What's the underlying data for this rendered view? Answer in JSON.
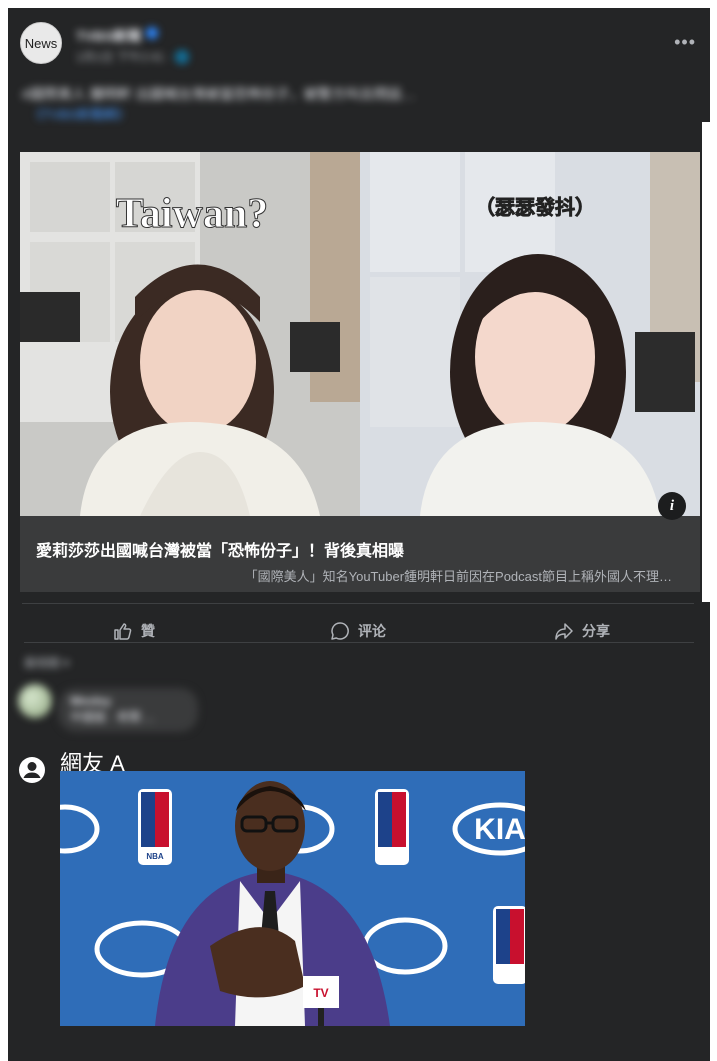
{
  "post": {
    "avatar_text": "News",
    "page_name": "TVBS新聞",
    "timestamp": "1月1日 下午2:41 · 🌐",
    "text": "#國際美人 鍾明軒 出國喊台灣被當恐怖份子，被警方叫去問話…",
    "link": "《TVBS新聞網》"
  },
  "link_card": {
    "image": {
      "left_caption": "Taiwan?",
      "right_caption": "（瑟瑟發抖）"
    },
    "title": "愛莉莎莎出國喊台灣被當「恐怖份子」！背後真相曝",
    "subtitle": "「國際美人」知名YouTuber鍾明軒日前因在Podcast節目上稱外國人不理…",
    "info_icon": "info-icon"
  },
  "actions": {
    "like_label": "贊",
    "comment_label": "评论",
    "share_label": "分享"
  },
  "comments": {
    "sort_label": "最相關 ▾",
    "first": {
      "name": "Wesley",
      "text": "中國版 · 老闆 ..."
    },
    "second": {
      "name": "網友 A",
      "image": {
        "banner_text": "KIA",
        "league_logo": "NBA",
        "mic_logo": "TV"
      }
    }
  },
  "colors": {
    "background": "#242526",
    "card": "#3a3b3c",
    "accent": "#4599ff",
    "muted_text": "#b0b3b8"
  }
}
